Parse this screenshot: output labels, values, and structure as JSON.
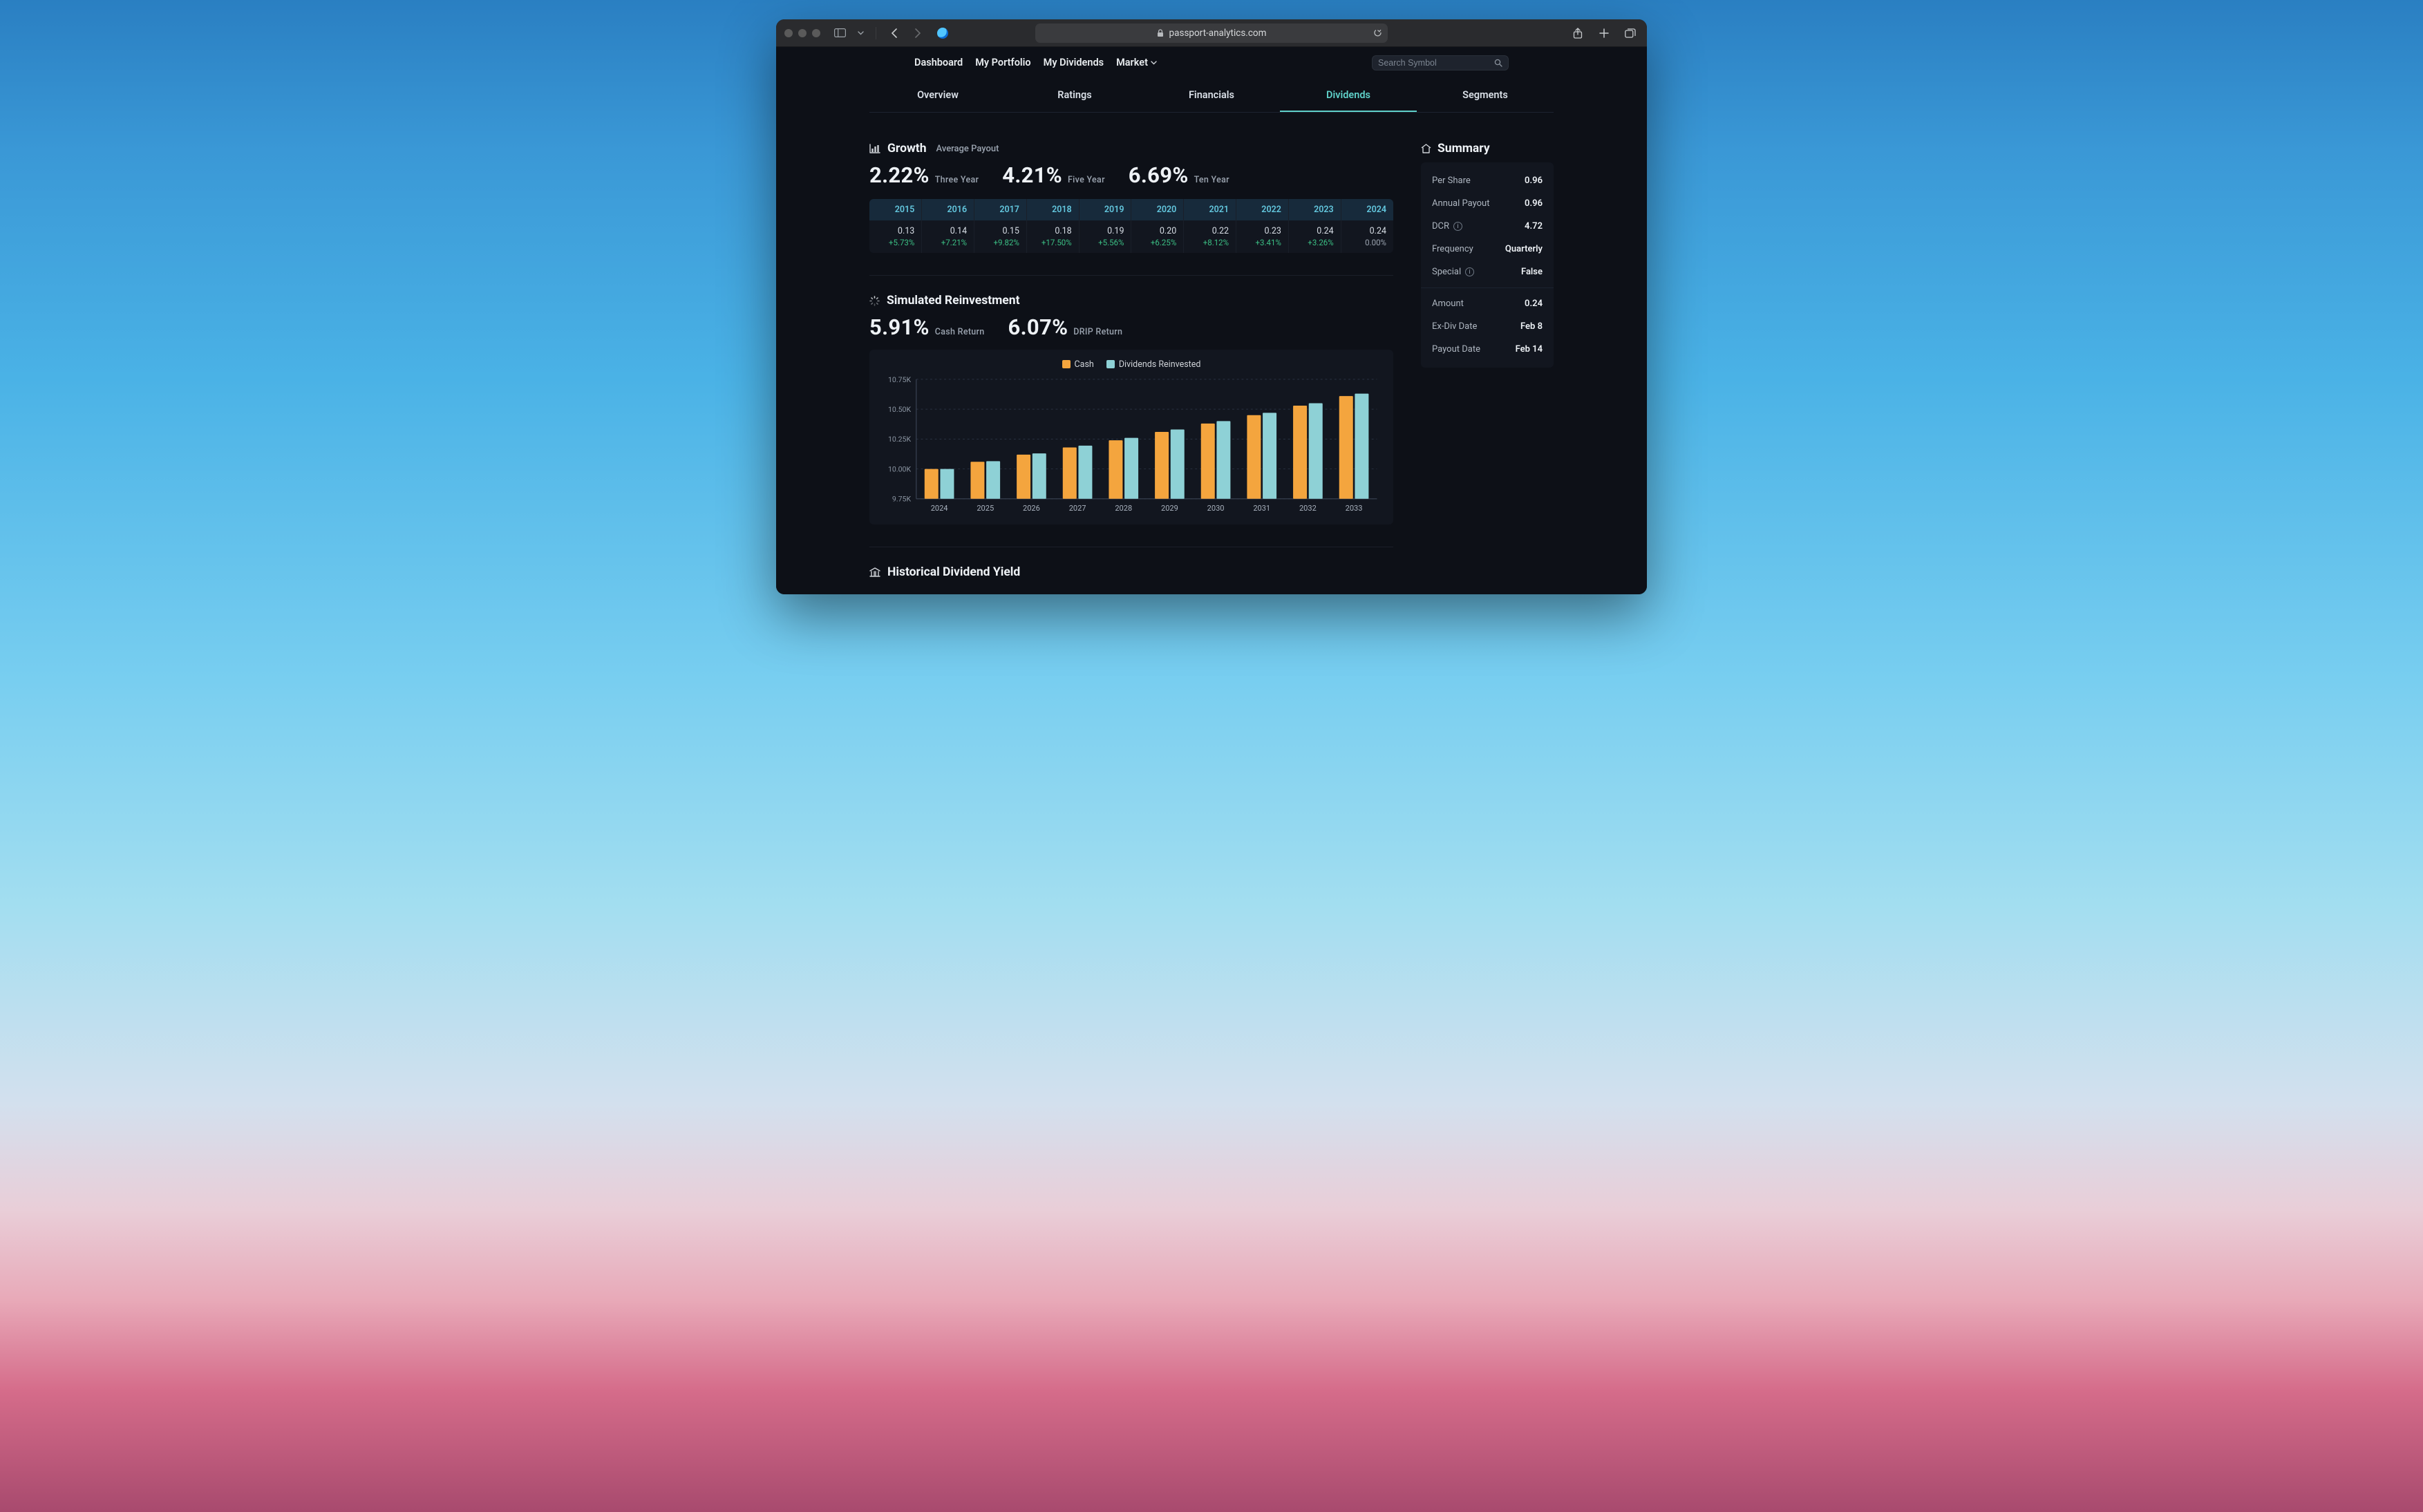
{
  "browser": {
    "url_display": "passport-analytics.com"
  },
  "nav": {
    "items": [
      "Dashboard",
      "My Portfolio",
      "My Dividends",
      "Market"
    ],
    "search_placeholder": "Search Symbol"
  },
  "tabs": {
    "items": [
      "Overview",
      "Ratings",
      "Financials",
      "Dividends",
      "Segments"
    ],
    "active_index": 3
  },
  "growth": {
    "title": "Growth",
    "subtitle": "Average Payout",
    "metrics": [
      {
        "value": "2.22%",
        "label": "Three Year"
      },
      {
        "value": "4.21%",
        "label": "Five Year"
      },
      {
        "value": "6.69%",
        "label": "Ten Year"
      }
    ],
    "table": {
      "years": [
        "2015",
        "2016",
        "2017",
        "2018",
        "2019",
        "2020",
        "2021",
        "2022",
        "2023",
        "2024"
      ],
      "amount": [
        "0.13",
        "0.14",
        "0.15",
        "0.18",
        "0.19",
        "0.20",
        "0.22",
        "0.23",
        "0.24",
        "0.24"
      ],
      "change": [
        "+5.73%",
        "+7.21%",
        "+9.82%",
        "+17.50%",
        "+5.56%",
        "+6.25%",
        "+8.12%",
        "+3.41%",
        "+3.26%",
        "0.00%"
      ]
    }
  },
  "reinvest": {
    "title": "Simulated Reinvestment",
    "metrics": [
      {
        "value": "5.91%",
        "label": "Cash Return"
      },
      {
        "value": "6.07%",
        "label": "DRIP Return"
      }
    ],
    "legend": [
      "Cash",
      "Dividends Reinvested"
    ]
  },
  "historical": {
    "title": "Historical Dividend Yield"
  },
  "summary": {
    "title": "Summary",
    "rows_a": [
      {
        "k": "Per Share",
        "v": "0.96"
      },
      {
        "k": "Annual Payout",
        "v": "0.96"
      },
      {
        "k": "DCR",
        "v": "4.72",
        "info": true
      },
      {
        "k": "Frequency",
        "v": "Quarterly"
      },
      {
        "k": "Special",
        "v": "False",
        "info": true
      }
    ],
    "rows_b": [
      {
        "k": "Amount",
        "v": "0.24"
      },
      {
        "k": "Ex-Div Date",
        "v": "Feb 8"
      },
      {
        "k": "Payout Date",
        "v": "Feb 14"
      }
    ]
  },
  "chart_data": {
    "type": "bar",
    "categories": [
      "2024",
      "2025",
      "2026",
      "2027",
      "2028",
      "2029",
      "2030",
      "2031",
      "2032",
      "2033"
    ],
    "series": [
      {
        "name": "Cash",
        "values": [
          10000,
          10060,
          10120,
          10180,
          10240,
          10310,
          10380,
          10450,
          10530,
          10610
        ]
      },
      {
        "name": "Dividends Reinvested",
        "values": [
          10000,
          10065,
          10130,
          10195,
          10260,
          10330,
          10400,
          10470,
          10550,
          10630
        ]
      }
    ],
    "ylabel": "",
    "ylim": [
      9750,
      10750
    ],
    "yticks": [
      9750,
      10000,
      10250,
      10500,
      10750
    ],
    "ytick_labels": [
      "9.75K",
      "10.00K",
      "10.25K",
      "10.50K",
      "10.75K"
    ],
    "colors": {
      "Cash": "#f4a53e",
      "Dividends Reinvested": "#8ed1d6"
    },
    "grid": true
  }
}
